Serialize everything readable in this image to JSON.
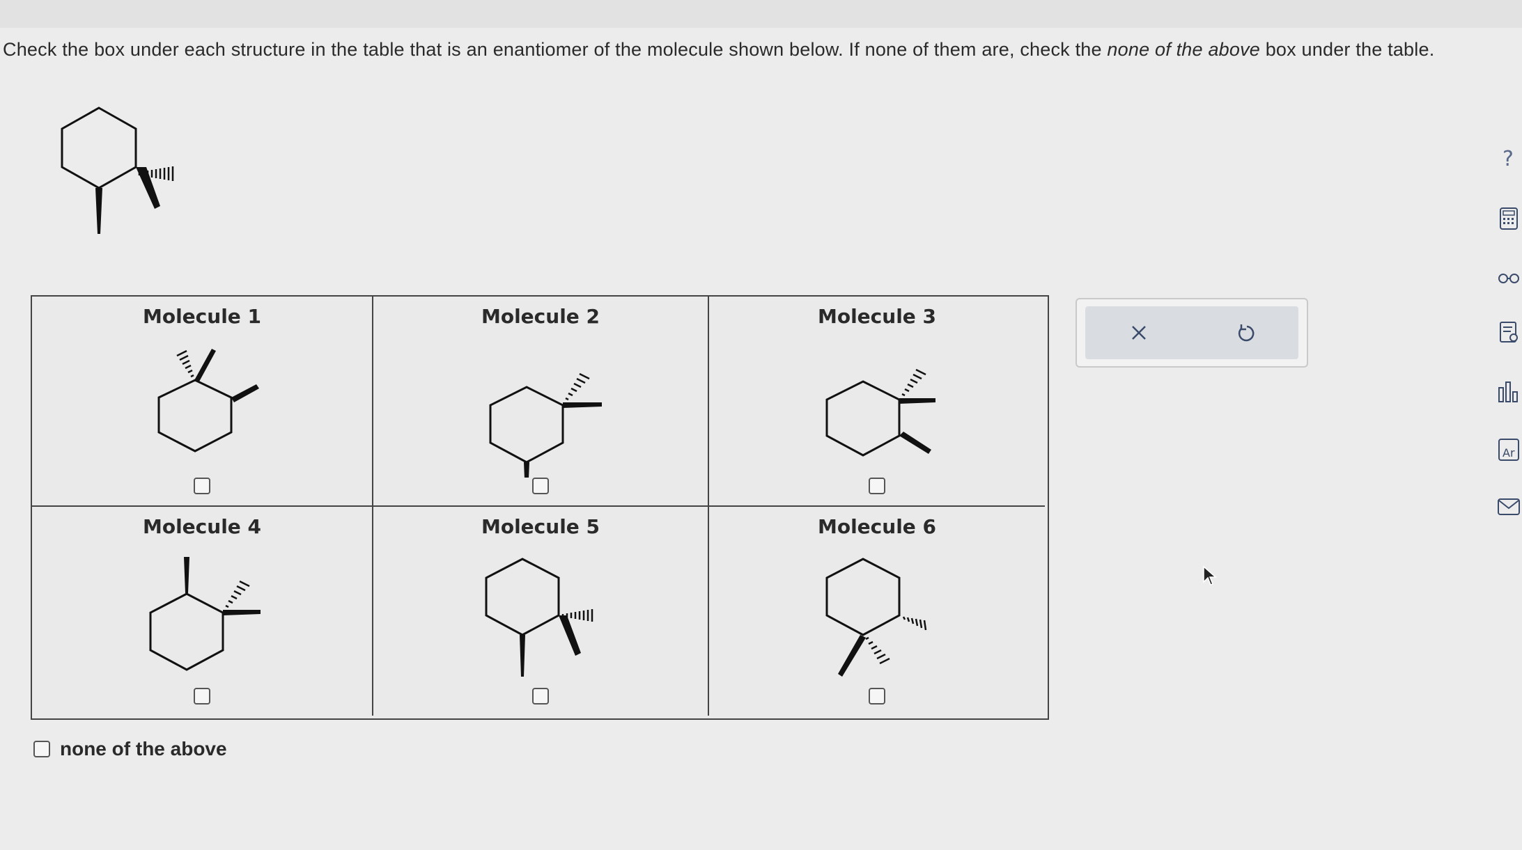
{
  "prompt": {
    "part1": "Check the box under each structure in the table that is an enantiomer of the molecule shown below. If none of them are, check the ",
    "emph": "none of the above",
    "part2": " box under the table."
  },
  "molecules": [
    {
      "label": "Molecule 1"
    },
    {
      "label": "Molecule 2"
    },
    {
      "label": "Molecule 3"
    },
    {
      "label": "Molecule 4"
    },
    {
      "label": "Molecule 5"
    },
    {
      "label": "Molecule 6"
    }
  ],
  "none_option": {
    "label": "none of the above"
  },
  "actions": {
    "clear_icon": "close-icon",
    "undo_icon": "undo-icon"
  },
  "side_tools": [
    "help-icon",
    "calculator-icon",
    "glasses-icon",
    "notes-icon",
    "chart-icon",
    "periodic-table-icon",
    "mail-icon"
  ]
}
